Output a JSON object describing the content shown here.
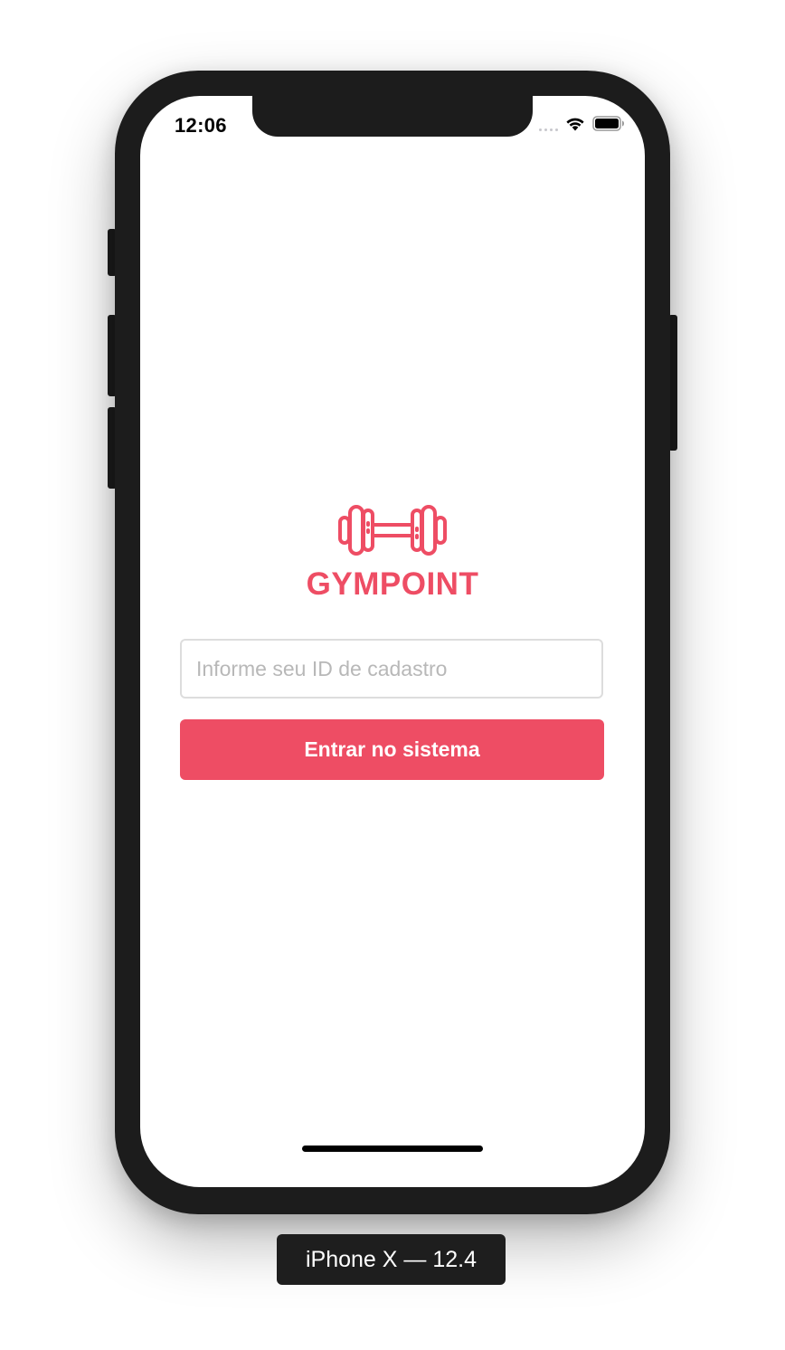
{
  "status_bar": {
    "time": "12:06",
    "icons": [
      "signal-dots-icon",
      "wifi-icon",
      "battery-icon"
    ]
  },
  "logo": {
    "icon": "dumbbell-icon",
    "brand": "GYMPOINT"
  },
  "form": {
    "id_placeholder": "Informe seu ID de cadastro",
    "id_value": "",
    "submit_label": "Entrar no sistema"
  },
  "simulator": {
    "device_label": "iPhone X — 12.4"
  },
  "colors": {
    "accent": "#ee4d64",
    "device_frame": "#1c1c1c",
    "input_border": "#dddddd",
    "placeholder": "#b8b8b8"
  }
}
